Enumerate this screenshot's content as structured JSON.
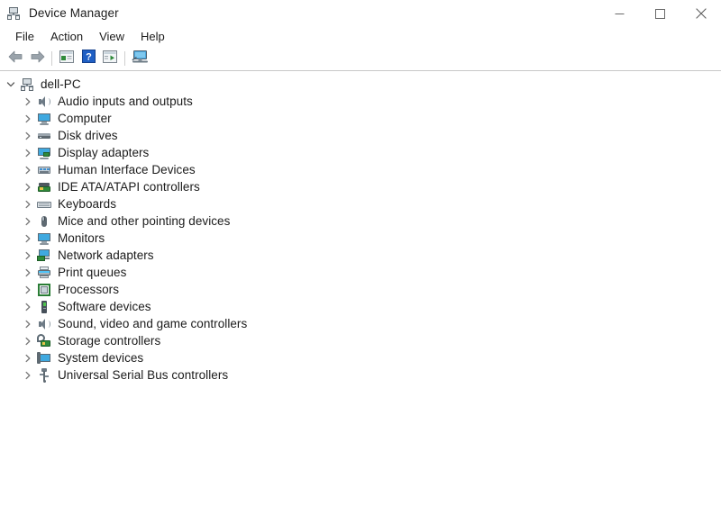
{
  "window": {
    "title": "Device Manager",
    "icon": "device-manager-icon",
    "controls": {
      "minimize": "minimize-button",
      "maximize": "maximize-button",
      "close": "close-button"
    }
  },
  "menubar": {
    "items": [
      {
        "label": "File",
        "name": "menu-file"
      },
      {
        "label": "Action",
        "name": "menu-action"
      },
      {
        "label": "View",
        "name": "menu-view"
      },
      {
        "label": "Help",
        "name": "menu-help"
      }
    ]
  },
  "toolbar": {
    "buttons": [
      {
        "name": "back-button",
        "icon": "back-arrow-icon",
        "title": "Back"
      },
      {
        "name": "forward-button",
        "icon": "forward-arrow-icon",
        "title": "Forward"
      },
      {
        "name": "separator-1",
        "icon": "separator"
      },
      {
        "name": "show-hide-console-tree-button",
        "icon": "console-tree-icon",
        "title": "Show/Hide Console Tree"
      },
      {
        "name": "help-button",
        "icon": "help-question-icon",
        "title": "Help"
      },
      {
        "name": "properties-button",
        "icon": "properties-icon",
        "title": "Properties"
      },
      {
        "name": "separator-2",
        "icon": "separator"
      },
      {
        "name": "scan-for-hardware-changes-button",
        "icon": "scan-hardware-icon",
        "title": "Scan for hardware changes"
      }
    ]
  },
  "tree": {
    "root": {
      "label": "dell-PC",
      "icon": "computer-root-icon",
      "expanded": true,
      "chevron": "chevron-down-icon"
    },
    "items": [
      {
        "label": "Audio inputs and outputs",
        "icon": "speaker-icon",
        "name": "tree-item-audio-inputs-and-outputs",
        "expanded": false
      },
      {
        "label": "Computer",
        "icon": "monitor-icon",
        "name": "tree-item-computer",
        "expanded": false
      },
      {
        "label": "Disk drives",
        "icon": "disk-drive-icon",
        "name": "tree-item-disk-drives",
        "expanded": false
      },
      {
        "label": "Display adapters",
        "icon": "display-adapter-icon",
        "name": "tree-item-display-adapters",
        "expanded": false
      },
      {
        "label": "Human Interface Devices",
        "icon": "human-interface-device-icon",
        "name": "tree-item-human-interface-devices",
        "expanded": false
      },
      {
        "label": "IDE ATA/ATAPI controllers",
        "icon": "ide-controller-icon",
        "name": "tree-item-ide-ata-atapi-controllers",
        "expanded": false
      },
      {
        "label": "Keyboards",
        "icon": "keyboard-icon",
        "name": "tree-item-keyboards",
        "expanded": false
      },
      {
        "label": "Mice and other pointing devices",
        "icon": "mouse-icon",
        "name": "tree-item-mice-and-other-pointing-devices",
        "expanded": false
      },
      {
        "label": "Monitors",
        "icon": "monitor-icon",
        "name": "tree-item-monitors",
        "expanded": false
      },
      {
        "label": "Network adapters",
        "icon": "network-adapter-icon",
        "name": "tree-item-network-adapters",
        "expanded": false
      },
      {
        "label": "Print queues",
        "icon": "printer-icon",
        "name": "tree-item-print-queues",
        "expanded": false
      },
      {
        "label": "Processors",
        "icon": "processor-icon",
        "name": "tree-item-processors",
        "expanded": false
      },
      {
        "label": "Software devices",
        "icon": "software-device-icon",
        "name": "tree-item-software-devices",
        "expanded": false
      },
      {
        "label": "Sound, video and game controllers",
        "icon": "speaker-icon",
        "name": "tree-item-sound-video-and-game-controllers",
        "expanded": false
      },
      {
        "label": "Storage controllers",
        "icon": "storage-controller-icon",
        "name": "tree-item-storage-controllers",
        "expanded": false
      },
      {
        "label": "System devices",
        "icon": "system-device-icon",
        "name": "tree-item-system-devices",
        "expanded": false
      },
      {
        "label": "Universal Serial Bus controllers",
        "icon": "usb-icon",
        "name": "tree-item-universal-serial-bus-controllers",
        "expanded": false
      }
    ]
  },
  "colors": {
    "window_background": "#ffffff",
    "text": "#1b1b1b",
    "toolbar_border": "#c8c8c8",
    "icon_blue": "#3fa9e0",
    "icon_green": "#2f8a3b",
    "icon_gray": "#6e7a84",
    "chevron": "#6f6f6f"
  }
}
